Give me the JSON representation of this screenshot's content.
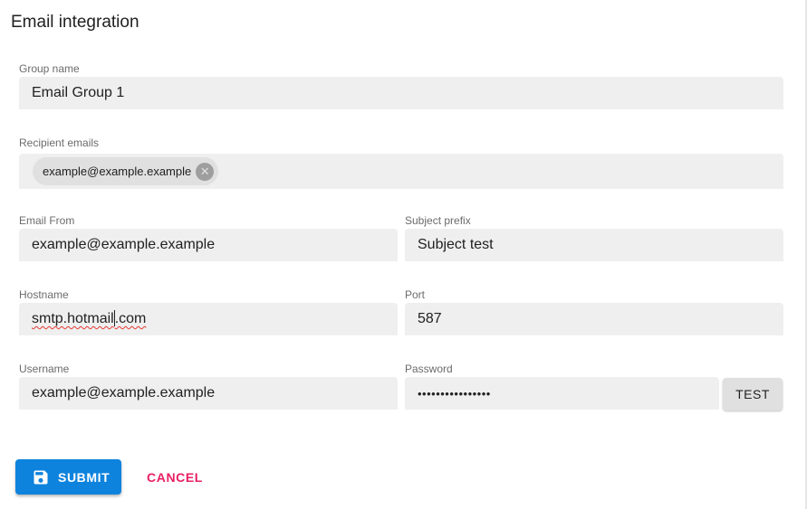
{
  "page": {
    "title": "Email integration"
  },
  "form": {
    "group_name": {
      "label": "Group name",
      "value": "Email Group 1"
    },
    "recipient_emails": {
      "label": "Recipient emails",
      "chips": [
        "example@example.example"
      ]
    },
    "email_from": {
      "label": "Email From",
      "value": "example@example.example"
    },
    "subject_prefix": {
      "label": "Subject prefix",
      "value": "Subject test"
    },
    "hostname": {
      "label": "Hostname",
      "value_before_caret": "smtp.hotmail",
      "value_after_caret": ".com"
    },
    "port": {
      "label": "Port",
      "value": "587"
    },
    "username": {
      "label": "Username",
      "value": "example@example.example"
    },
    "password": {
      "label": "Password",
      "value": "••••••••••••••••"
    }
  },
  "actions": {
    "test_label": "TEST",
    "submit_label": "SUBMIT",
    "cancel_label": "CANCEL"
  },
  "icons": {
    "chip_remove": "cancel-circle-icon",
    "submit": "save-icon"
  },
  "colors": {
    "primary": "#0d83dd",
    "cancel": "#e91e63",
    "field_bg": "#efefef"
  }
}
